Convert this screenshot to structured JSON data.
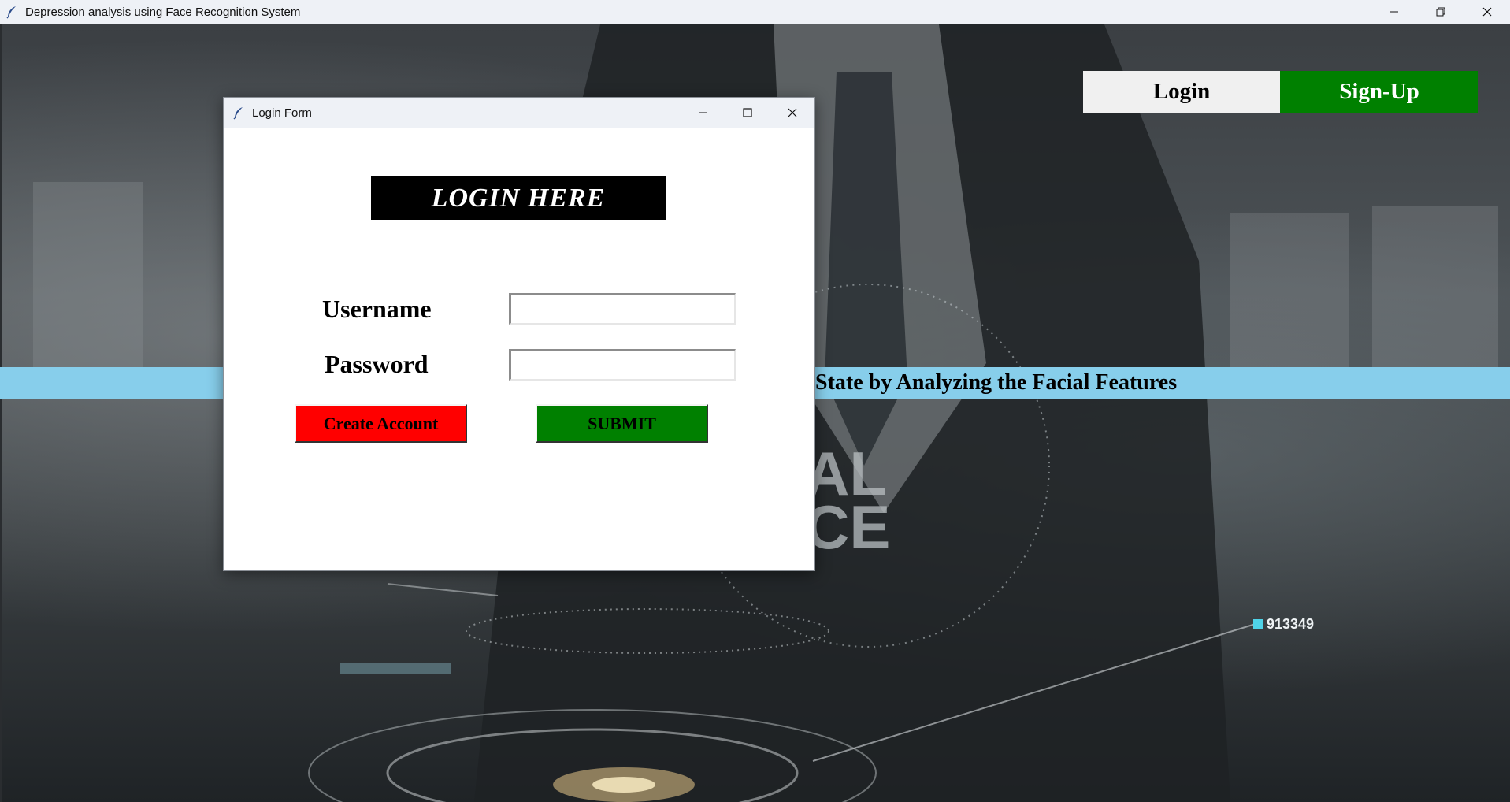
{
  "window": {
    "title": "Depression analysis using Face Recognition System",
    "icon": "feather-icon",
    "controls": [
      "minimize-icon",
      "restore-icon",
      "close-icon"
    ]
  },
  "top_nav": {
    "login_label": "Login",
    "signup_label": "Sign-Up"
  },
  "banner": {
    "text": "State by Analyzing the Facial Features"
  },
  "background_overlays": {
    "number_1": "913349",
    "big_text_1": "AL",
    "big_text_2": "CE"
  },
  "dialog": {
    "title": "Login Form",
    "icon": "feather-icon",
    "heading": "LOGIN HERE",
    "username_label": "Username",
    "password_label": "Password",
    "username_value": "",
    "password_value": "",
    "create_account_label": "Create Account",
    "submit_label": "SUBMIT"
  },
  "colors": {
    "signup_bg": "#008000",
    "login_bg": "#f0f0f0",
    "banner_bg": "#87ceeb",
    "create_bg": "#ff0000",
    "submit_bg": "#008000",
    "heading_bg": "#000000"
  }
}
